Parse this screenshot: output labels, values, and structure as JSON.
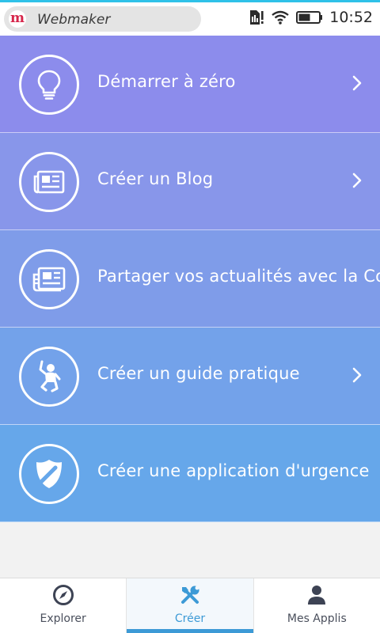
{
  "statusbar": {
    "app_name": "Webmaker",
    "logo_letter": "m",
    "time": "10:52",
    "colors": {
      "accent": "#2fc1e8",
      "logo": "#d6254a"
    }
  },
  "list": {
    "items": [
      {
        "label": "Démarrer à zéro",
        "icon": "lightbulb-icon",
        "has_chevron": true,
        "color": "#8c8cec"
      },
      {
        "label": "Créer un Blog",
        "icon": "newspaper-icon",
        "has_chevron": true,
        "color": "#8896ea"
      },
      {
        "label": "Partager vos actualités avec la Co",
        "icon": "news-share-icon",
        "has_chevron": false,
        "color": "#7f9ce9"
      },
      {
        "label": "Créer un guide pratique",
        "icon": "person-guide-icon",
        "has_chevron": true,
        "color": "#73a2ea"
      },
      {
        "label": "Créer une application d'urgence",
        "icon": "badge-shield-icon",
        "has_chevron": false,
        "color": "#66a7ea"
      }
    ]
  },
  "bottomnav": {
    "tabs": [
      {
        "label": "Explorer",
        "icon": "compass-icon",
        "active": false
      },
      {
        "label": "Créer",
        "icon": "tools-icon",
        "active": true
      },
      {
        "label": "Mes Applis",
        "icon": "user-icon",
        "active": false
      }
    ],
    "active_color": "#3c9ad6"
  }
}
